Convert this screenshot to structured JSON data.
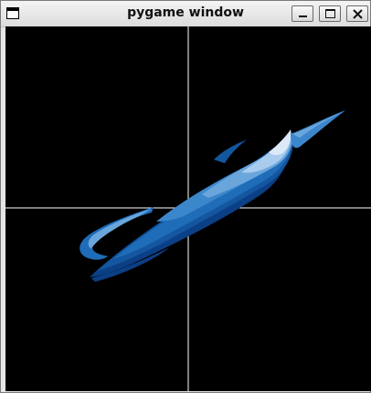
{
  "window": {
    "title": "pygame window",
    "icon": "app-window-icon",
    "controls": {
      "minimize": "minimize-icon",
      "maximize": "maximize-icon",
      "close": "close-icon"
    }
  },
  "scene": {
    "background": "#000000",
    "axis_color": "#ffffff",
    "shape_colors": [
      "#0b3f86",
      "#14569f",
      "#1f6cb8",
      "#3c86cc",
      "#6aa6dc",
      "#a8cbee",
      "#dceaf8"
    ]
  }
}
